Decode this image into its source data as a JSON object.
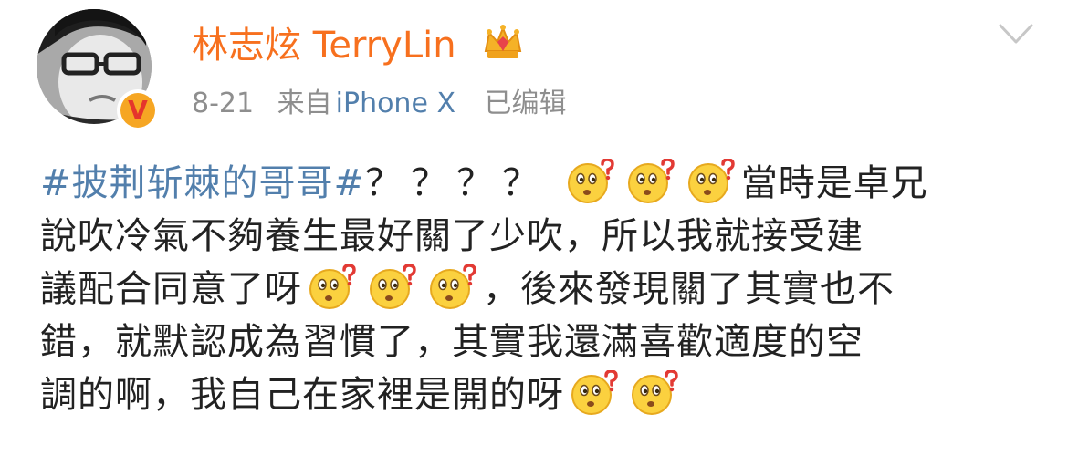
{
  "post": {
    "author": {
      "name": "林志炫 TerryLin",
      "avatar_icon": "person-with-glasses-avatar",
      "badge_icon": "verified-v-badge",
      "membership_icon": "crown-icon"
    },
    "meta": {
      "date": "8-21",
      "source_prefix": "来自",
      "source": "iPhone X",
      "edited": "已编辑"
    },
    "more_icon": "chevron-down-icon",
    "content": {
      "hashtag": "#披荆斩棘的哥哥#",
      "question_marks": "？？？？",
      "emoji_icon": "puzzled-face-emoji",
      "line1_tail": "當時是卓兄",
      "line2": "說吹冷氣不夠養生最好關了少吹，所以我就接受建",
      "line3_head": "議配合同意了呀",
      "line3_tail": "，後來發現關了其實也不",
      "line4": "錯，就默認成為習慣了，其實我還滿喜歡適度的空",
      "line5_head": "調的啊，我自己在家裡是開的呀"
    }
  },
  "colors": {
    "username": "#f7701e",
    "link": "#527fac",
    "meta_text": "#8e8e8e",
    "body_text": "#222222",
    "badge": "#f6a623"
  }
}
